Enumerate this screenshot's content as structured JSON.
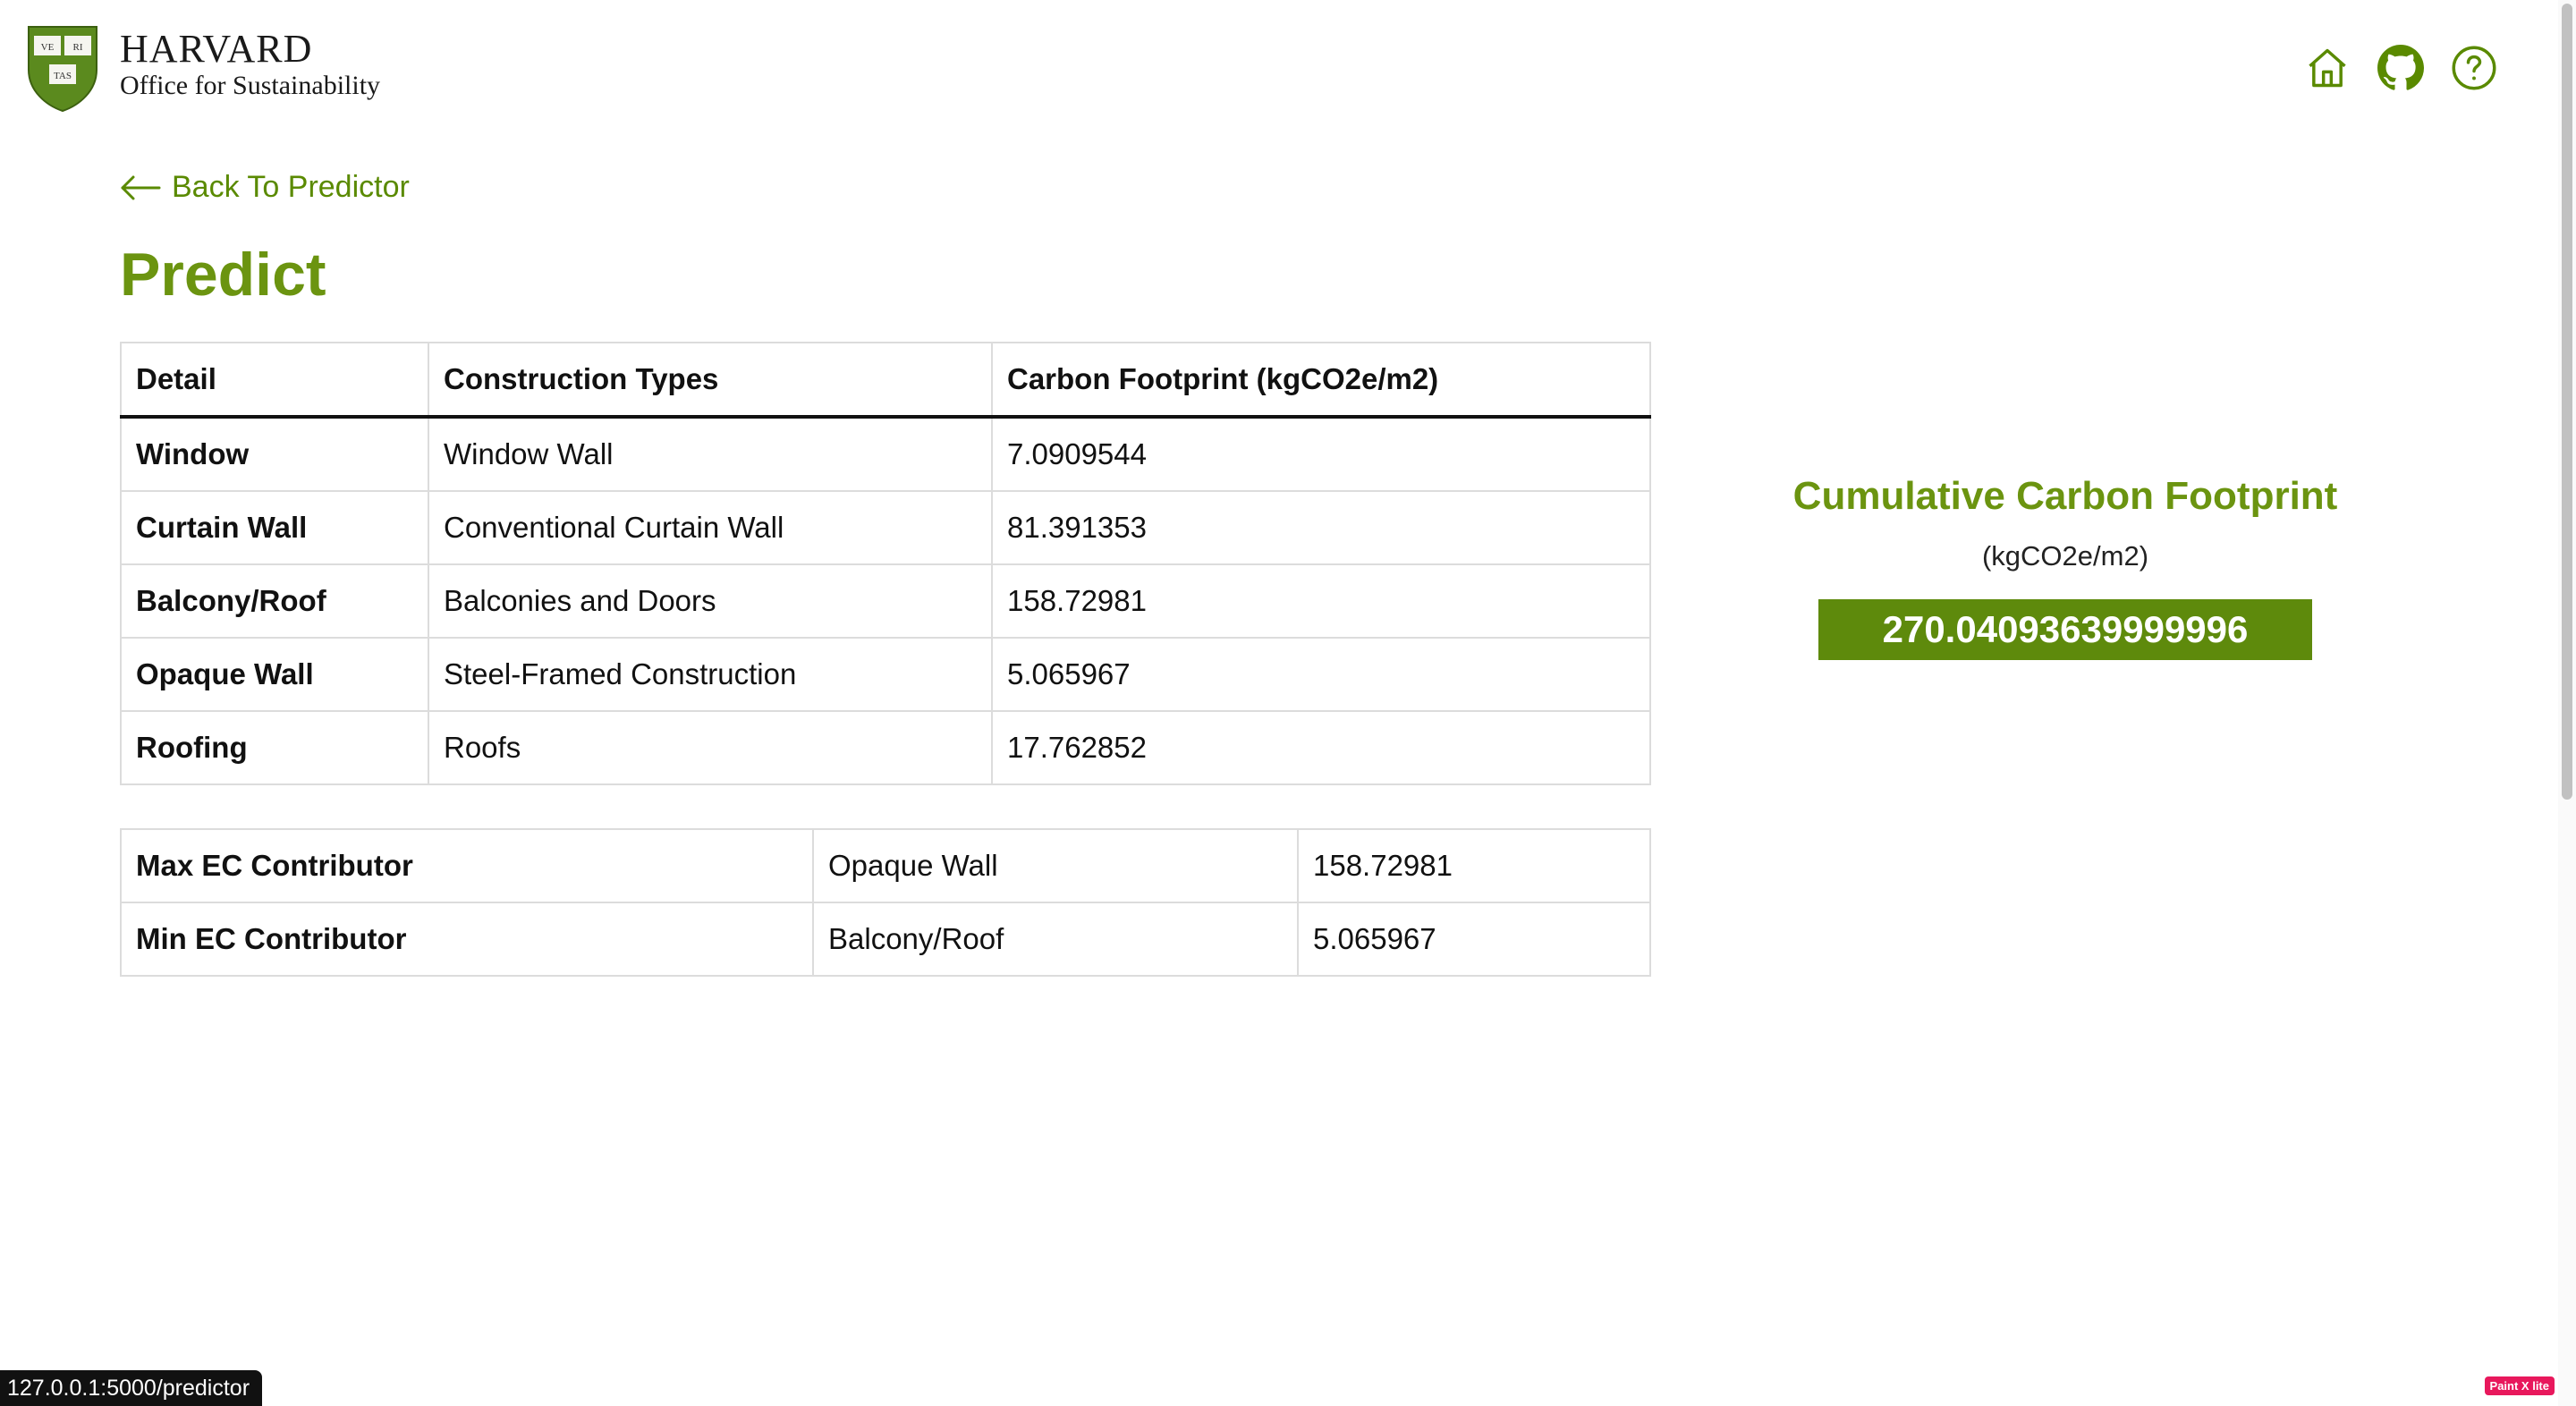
{
  "header": {
    "brand_name": "HARVARD",
    "brand_sub": "Office for Sustainability",
    "shield_letters": [
      "VE",
      "RI",
      "TAS"
    ],
    "icons": [
      "home-icon",
      "github-icon",
      "help-icon"
    ]
  },
  "nav": {
    "back_label": "Back To Predictor"
  },
  "page": {
    "title": "Predict"
  },
  "detail_table": {
    "headers": [
      "Detail",
      "Construction Types",
      "Carbon Footprint (kgCO2e/m2)"
    ],
    "rows": [
      [
        "Window",
        "Window Wall",
        "7.0909544"
      ],
      [
        "Curtain Wall",
        "Conventional Curtain Wall",
        "81.391353"
      ],
      [
        "Balcony/Roof",
        "Balconies and Doors",
        "158.72981"
      ],
      [
        "Opaque Wall",
        "Steel-Framed Construction",
        "5.065967"
      ],
      [
        "Roofing",
        "Roofs",
        "17.762852"
      ]
    ]
  },
  "contributor_table": {
    "rows": [
      [
        "Max EC Contributor",
        "Opaque Wall",
        "158.72981"
      ],
      [
        "Min EC Contributor",
        "Balcony/Roof",
        "5.065967"
      ]
    ]
  },
  "cumulative": {
    "title": "Cumulative Carbon Footprint",
    "unit": "(kgCO2e/m2)",
    "value": "270.04093639999996"
  },
  "status_bar": {
    "url": "127.0.0.1:5000/predictor"
  },
  "extension_badge": {
    "label": "Paint X lite"
  },
  "colors": {
    "accent": "#6b9410",
    "value_box": "#5e8a0c",
    "brand_shield": "#5b8a1e"
  }
}
